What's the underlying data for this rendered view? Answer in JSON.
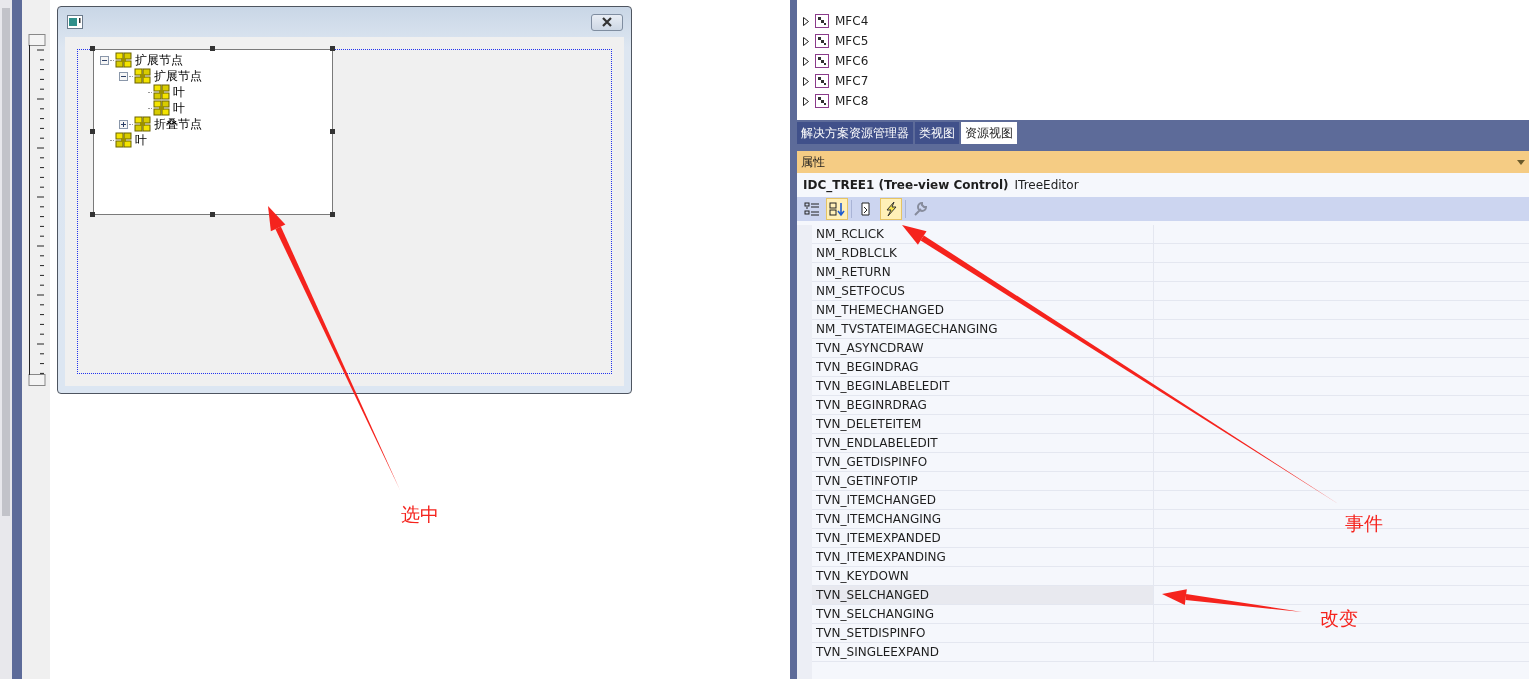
{
  "dialog": {
    "tree_items": [
      {
        "label": "扩展节点",
        "expanded": true,
        "children": [
          {
            "label": "扩展节点",
            "expanded": true,
            "children": [
              {
                "label": "叶"
              },
              {
                "label": "叶"
              }
            ]
          },
          {
            "label": "折叠节点",
            "expanded": false
          }
        ]
      },
      {
        "label": "叶"
      }
    ]
  },
  "resource_tree": [
    {
      "label": "MFC4"
    },
    {
      "label": "MFC5"
    },
    {
      "label": "MFC6"
    },
    {
      "label": "MFC7"
    },
    {
      "label": "MFC8"
    }
  ],
  "tabs": [
    {
      "label": "解决方案资源管理器",
      "selected": false
    },
    {
      "label": "类视图",
      "selected": false
    },
    {
      "label": "资源视图",
      "selected": true
    }
  ],
  "properties": {
    "title": "属性",
    "object_name": "IDC_TREE1 (Tree-view Control)",
    "object_type": "ITreeEditor",
    "toolbar": [
      {
        "kind": "categorized",
        "selected": false,
        "disabled": false
      },
      {
        "kind": "alphabetical",
        "selected": true,
        "disabled": false
      },
      {
        "kind": "properties",
        "selected": false,
        "disabled": false
      },
      {
        "kind": "events",
        "selected": true,
        "disabled": false
      },
      {
        "kind": "property-pages",
        "selected": false,
        "disabled": true
      }
    ],
    "events": [
      {
        "name": "NM_RCLICK",
        "selected": false
      },
      {
        "name": "NM_RDBLCLK",
        "selected": false
      },
      {
        "name": "NM_RETURN",
        "selected": false
      },
      {
        "name": "NM_SETFOCUS",
        "selected": false
      },
      {
        "name": "NM_THEMECHANGED",
        "selected": false
      },
      {
        "name": "NM_TVSTATEIMAGECHANGING",
        "selected": false
      },
      {
        "name": "TVN_ASYNCDRAW",
        "selected": false
      },
      {
        "name": "TVN_BEGINDRAG",
        "selected": false
      },
      {
        "name": "TVN_BEGINLABELEDIT",
        "selected": false
      },
      {
        "name": "TVN_BEGINRDRAG",
        "selected": false
      },
      {
        "name": "TVN_DELETEITEM",
        "selected": false
      },
      {
        "name": "TVN_ENDLABELEDIT",
        "selected": false
      },
      {
        "name": "TVN_GETDISPINFO",
        "selected": false
      },
      {
        "name": "TVN_GETINFOTIP",
        "selected": false
      },
      {
        "name": "TVN_ITEMCHANGED",
        "selected": false
      },
      {
        "name": "TVN_ITEMCHANGING",
        "selected": false
      },
      {
        "name": "TVN_ITEMEXPANDED",
        "selected": false
      },
      {
        "name": "TVN_ITEMEXPANDING",
        "selected": false
      },
      {
        "name": "TVN_KEYDOWN",
        "selected": false
      },
      {
        "name": "TVN_SELCHANGED",
        "selected": true
      },
      {
        "name": "TVN_SELCHANGING",
        "selected": false
      },
      {
        "name": "TVN_SETDISPINFO",
        "selected": false
      },
      {
        "name": "TVN_SINGLEEXPAND",
        "selected": false
      }
    ]
  },
  "annotations": [
    {
      "text": "选中"
    },
    {
      "text": "事件"
    },
    {
      "text": "改变"
    }
  ]
}
